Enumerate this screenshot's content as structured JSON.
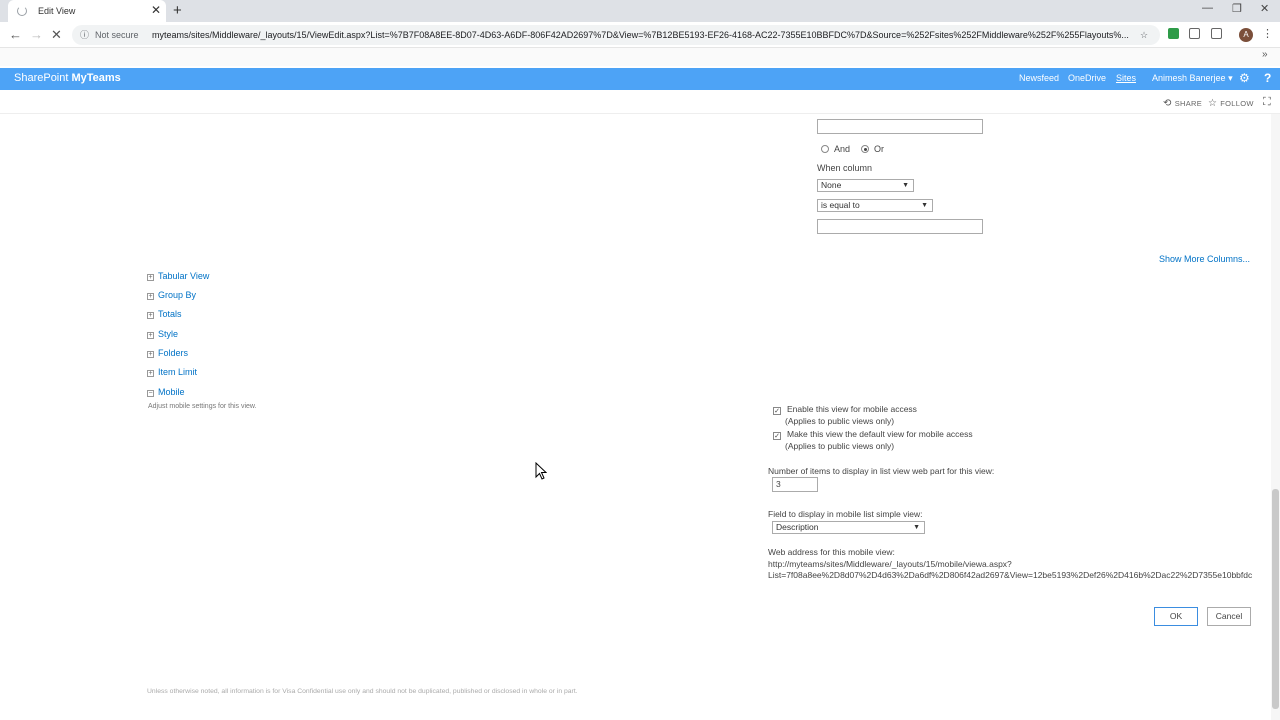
{
  "browser": {
    "tab_title": "Edit View",
    "not_secure": "Not secure",
    "url": "myteams/sites/Middleware/_layouts/15/ViewEdit.aspx?List=%7B7F08A8EE-8D07-4D63-A6DF-806F42AD2697%7D&View=%7B12BE5193-EF26-4168-AC22-7355E10BBFDC%7D&Source=%252Fsites%252FMiddleware%252F%255Flayouts%...",
    "avatar_letter": "A"
  },
  "suitebar": {
    "brand_prefix": "SharePoint ",
    "brand_name": "MyTeams",
    "links": [
      "Newsfeed",
      "OneDrive",
      "Sites"
    ],
    "user": "Animesh Banerjee",
    "accent": "#4da3f6"
  },
  "actions": {
    "share": "SHARE",
    "follow": "FOLLOW"
  },
  "filter": {
    "and_label": "And",
    "or_label": "Or",
    "when_column": "When column",
    "column_value": "None",
    "operator_value": "is equal to",
    "show_more": "Show More Columns..."
  },
  "sections": [
    "Tabular View",
    "Group By",
    "Totals",
    "Style",
    "Folders",
    "Item Limit",
    "Mobile"
  ],
  "mobile": {
    "description": "Adjust mobile settings for this view.",
    "enable_label": "Enable this view for mobile access",
    "enable_note": "(Applies to public views only)",
    "default_label": "Make this view the default view for mobile access",
    "default_note": "(Applies to public views only)",
    "items_label": "Number of items to display in list view web part for this view:",
    "items_value": "3",
    "field_label": "Field to display in mobile list simple view:",
    "field_value": "Description",
    "web_label": "Web address for this mobile view:",
    "web_line1": "http://myteams/sites/Middleware/_layouts/15/mobile/viewa.aspx?",
    "web_line2": "List=7f08a8ee%2D8d07%2D4d63%2Da6df%2D806f42ad2697&View=12be5193%2Def26%2D416b%2Dac22%2D7355e10bbfdc"
  },
  "buttons": {
    "ok": "OK",
    "cancel": "Cancel"
  },
  "footer": "Unless otherwise noted, all information is for Visa Confidential use only and should not be duplicated, published or disclosed in whole or in part."
}
